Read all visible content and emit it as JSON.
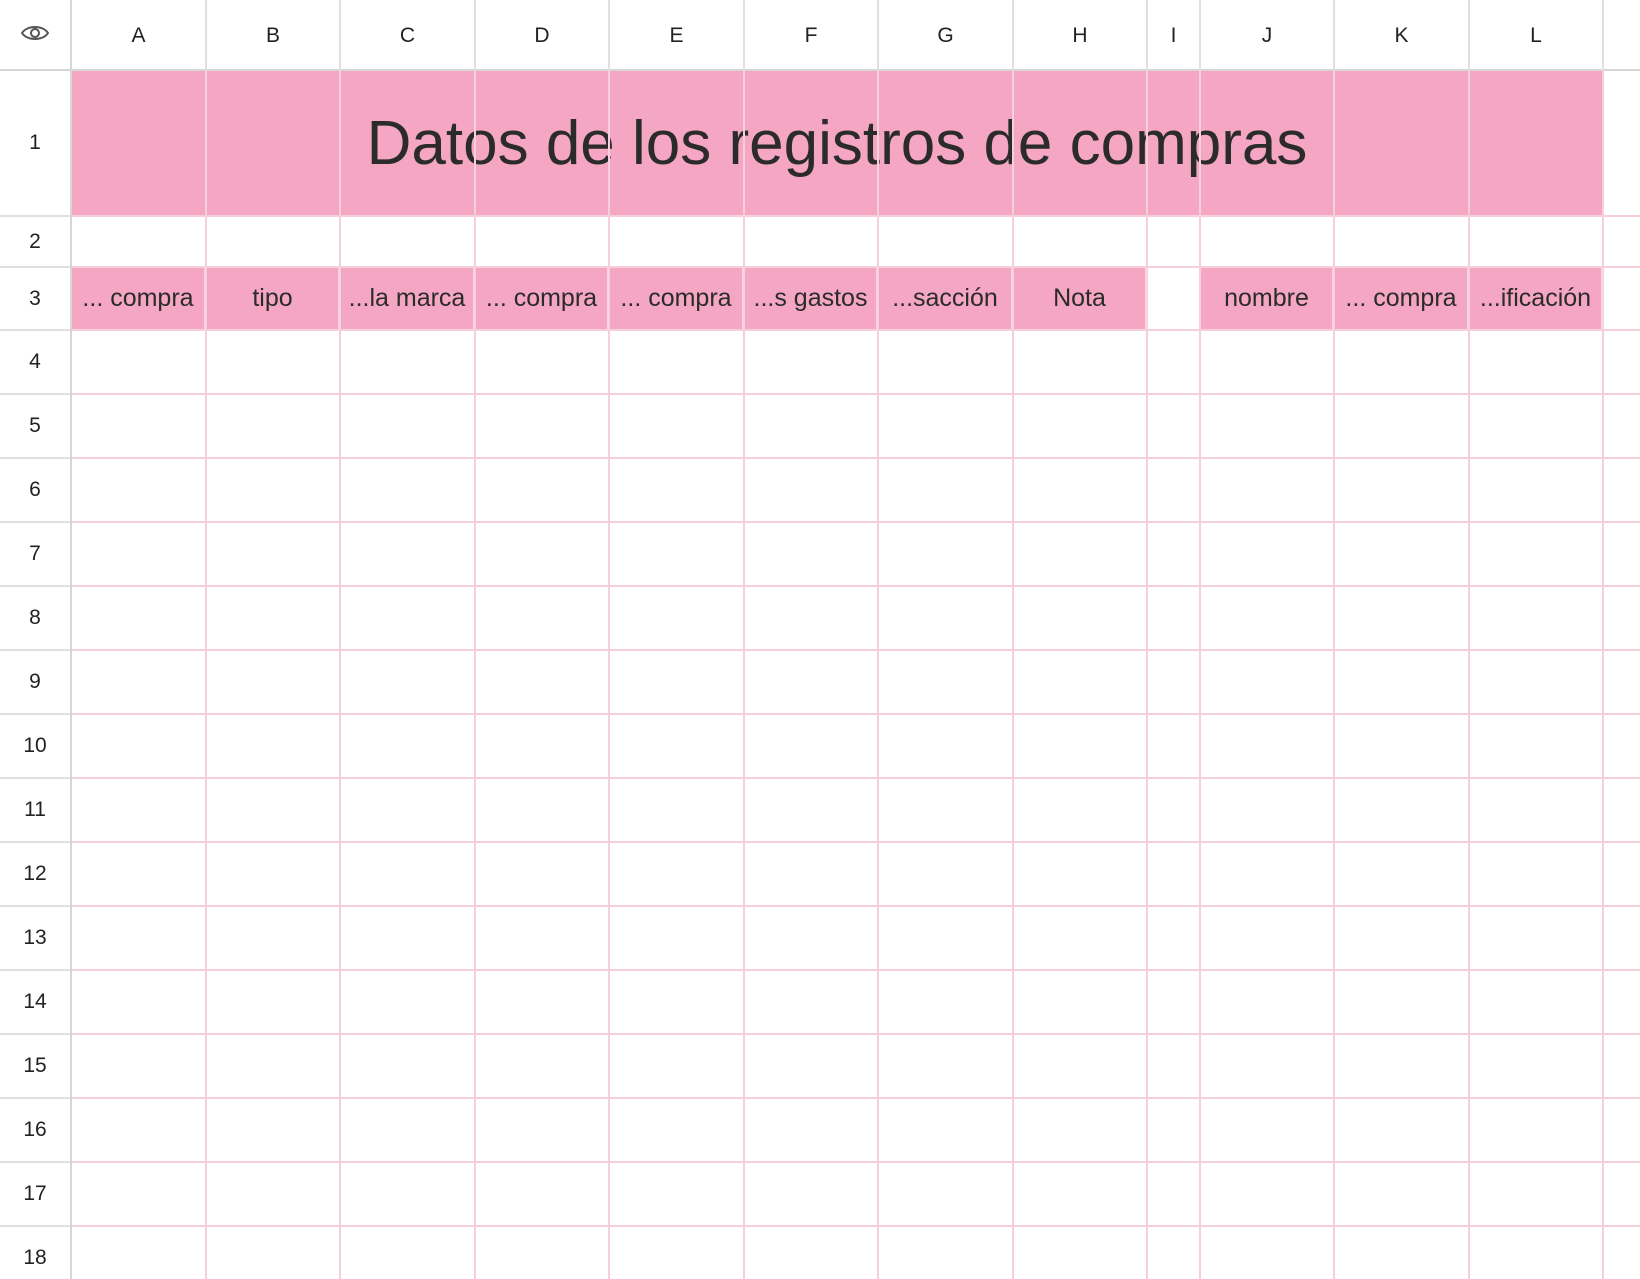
{
  "sheet": {
    "columns": [
      "A",
      "B",
      "C",
      "D",
      "E",
      "F",
      "G",
      "H",
      "I",
      "J",
      "K",
      "L"
    ],
    "rows": [
      "1",
      "2",
      "3",
      "4",
      "5",
      "6",
      "7",
      "8",
      "9",
      "10",
      "11",
      "12",
      "13",
      "14",
      "15",
      "16",
      "17",
      "18"
    ],
    "title": "Datos de los registros de compras",
    "headers": {
      "A": "... compra",
      "B": "tipo",
      "C": "...la marca",
      "D": "... compra",
      "E": "... compra",
      "F": "...s gastos",
      "G": "...sacción",
      "H": "Nota",
      "J": "nombre",
      "K": "... compra",
      "L": "...ificación"
    },
    "icons": {
      "corner": "eye-icon"
    },
    "colors": {
      "header_fill": "#f4a6c3",
      "gridline": "#f6cfdd"
    }
  }
}
